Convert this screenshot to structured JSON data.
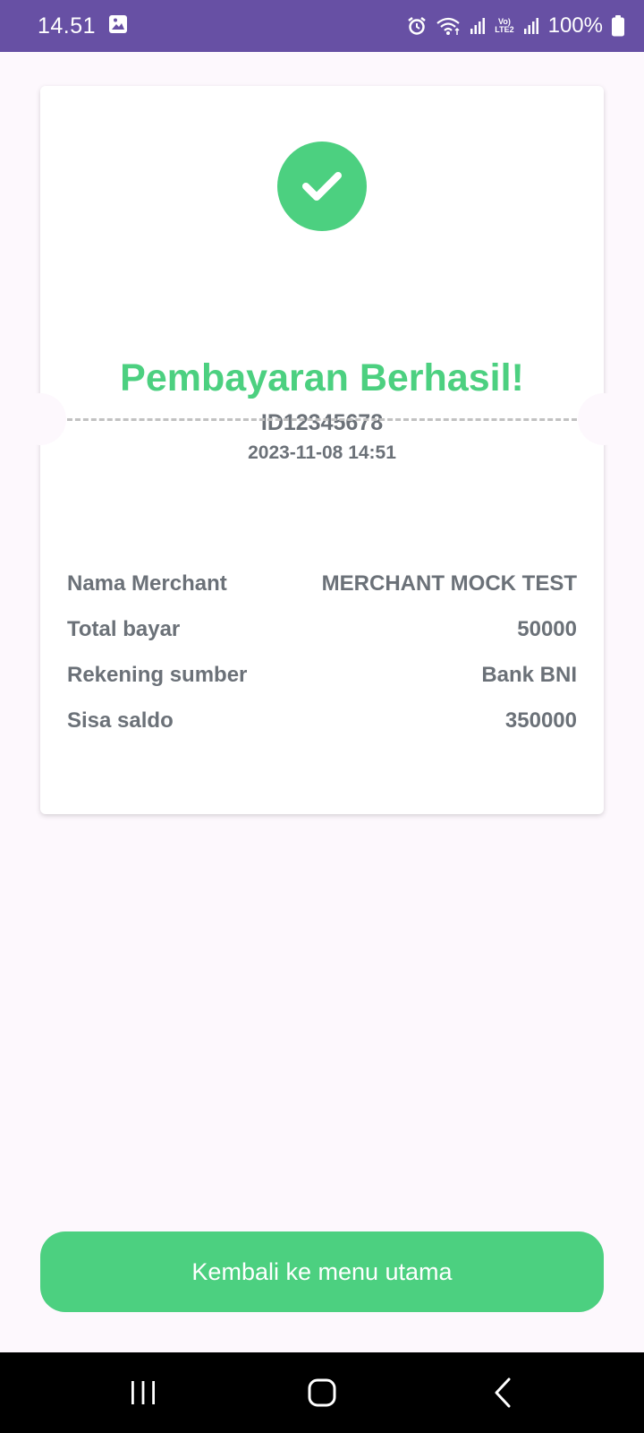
{
  "status_bar": {
    "time": "14.51",
    "battery": "100%",
    "icons": [
      "gallery-icon",
      "alarm-icon",
      "wifi-icon",
      "signal-icon",
      "volte-lte2-icon",
      "signal-icon",
      "battery-icon"
    ],
    "volte_label": "Vo)",
    "lte_label": "LTE2"
  },
  "receipt": {
    "status_icon": "check-icon",
    "title": "Pembayaran Berhasil!",
    "transaction_id": "ID12345678",
    "datetime": "2023-11-08 14:51",
    "details": [
      {
        "label": "Nama Merchant",
        "value": "MERCHANT MOCK TEST"
      },
      {
        "label": "Total bayar",
        "value": "50000"
      },
      {
        "label": "Rekening sumber",
        "value": "Bank BNI"
      },
      {
        "label": "Sisa saldo",
        "value": "350000"
      }
    ]
  },
  "actions": {
    "home_button_label": "Kembali ke menu utama"
  },
  "nav_bar": {
    "icons": [
      "recent-apps-icon",
      "home-icon",
      "back-icon"
    ]
  },
  "colors": {
    "status_bar": "#6750a4",
    "accent_green": "#4cd080",
    "text_gray": "#6b7178",
    "background": "#fdf8fd"
  }
}
